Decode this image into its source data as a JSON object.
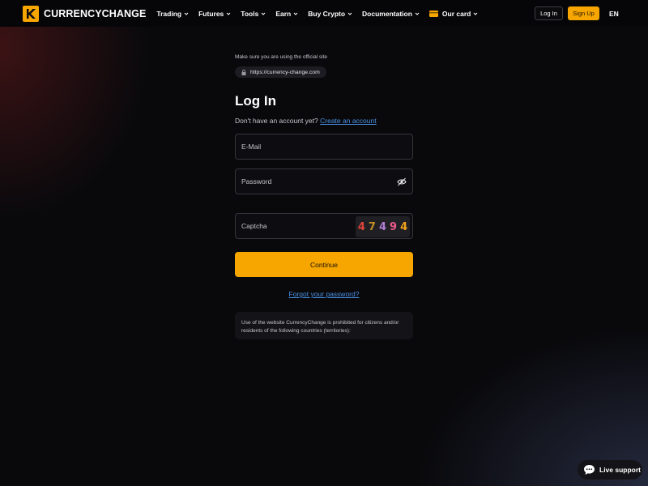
{
  "header": {
    "brand": "CURRENCYCHANGE",
    "nav": [
      {
        "label": "Trading"
      },
      {
        "label": "Futures"
      },
      {
        "label": "Tools"
      },
      {
        "label": "Earn"
      },
      {
        "label": "Buy Crypto"
      },
      {
        "label": "Documentation"
      },
      {
        "label": "Our card"
      }
    ],
    "login_label": "Log In",
    "signup_label": "Sign Up",
    "language": "EN"
  },
  "login": {
    "official_note": "Make sure you are using the official site",
    "official_url": "https://currency-change.com",
    "title": "Log In",
    "no_account_text": "Don't have an account yet?",
    "create_account_link": "Create an account",
    "email_placeholder": "E-Mail",
    "password_placeholder": "Password",
    "captcha_placeholder": "Captcha",
    "captcha_digits": [
      {
        "char": "4",
        "color": "#e0453a"
      },
      {
        "char": "7",
        "color": "#c28f22"
      },
      {
        "char": "4",
        "color": "#b07fd6"
      },
      {
        "char": "9",
        "color": "#ef5a8a"
      },
      {
        "char": "4",
        "color": "#f2a31c"
      }
    ],
    "continue_label": "Continue",
    "forgot_link": "Forgot your password?",
    "restriction_notice": "Use of the website CurrencyChange is prohibited for citizens and/or residents of the following countries (territories):"
  },
  "support": {
    "label": "Live support"
  },
  "colors": {
    "accent": "#f7a600",
    "link": "#4a90e2",
    "background": "#09090c"
  },
  "icons": [
    "logo-mark-icon",
    "chevron-down-icon",
    "card-icon",
    "lock-icon",
    "eye-off-icon",
    "chat-bubble-icon"
  ]
}
